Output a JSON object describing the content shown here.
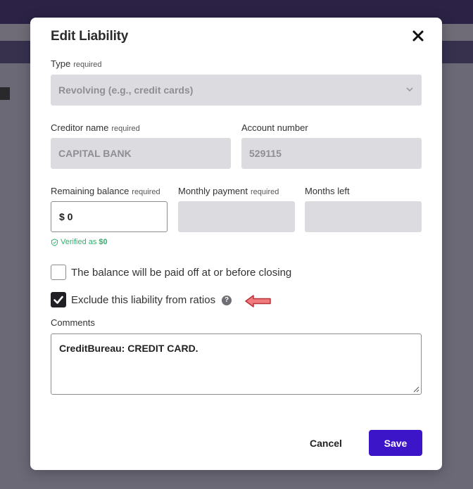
{
  "modal": {
    "title": "Edit Liability",
    "close_icon": "close-icon"
  },
  "type_field": {
    "label": "Type",
    "required": "required",
    "value": "Revolving (e.g., credit cards)"
  },
  "creditor_field": {
    "label": "Creditor name",
    "required": "required",
    "value": "CAPITAL BANK"
  },
  "account_field": {
    "label": "Account number",
    "value": "529115"
  },
  "balance_field": {
    "label": "Remaining balance",
    "required": "required",
    "value": "$ 0",
    "verified_text": "Verified as",
    "verified_value": "$0"
  },
  "payment_field": {
    "label": "Monthly payment",
    "required": "required",
    "value": ""
  },
  "months_field": {
    "label": "Months left",
    "value": ""
  },
  "paid_off_checkbox": {
    "label": "The balance will be paid off at or before closing",
    "checked": false
  },
  "exclude_checkbox": {
    "label": "Exclude this liability from ratios",
    "checked": true,
    "help_icon": "?"
  },
  "comments": {
    "label": "Comments",
    "value": "CreditBureau: CREDIT CARD."
  },
  "footer": {
    "cancel_label": "Cancel",
    "save_label": "Save"
  },
  "colors": {
    "accent": "#3d15c8",
    "verified": "#2fb36e",
    "annotation_arrow": "#f07a7e"
  }
}
